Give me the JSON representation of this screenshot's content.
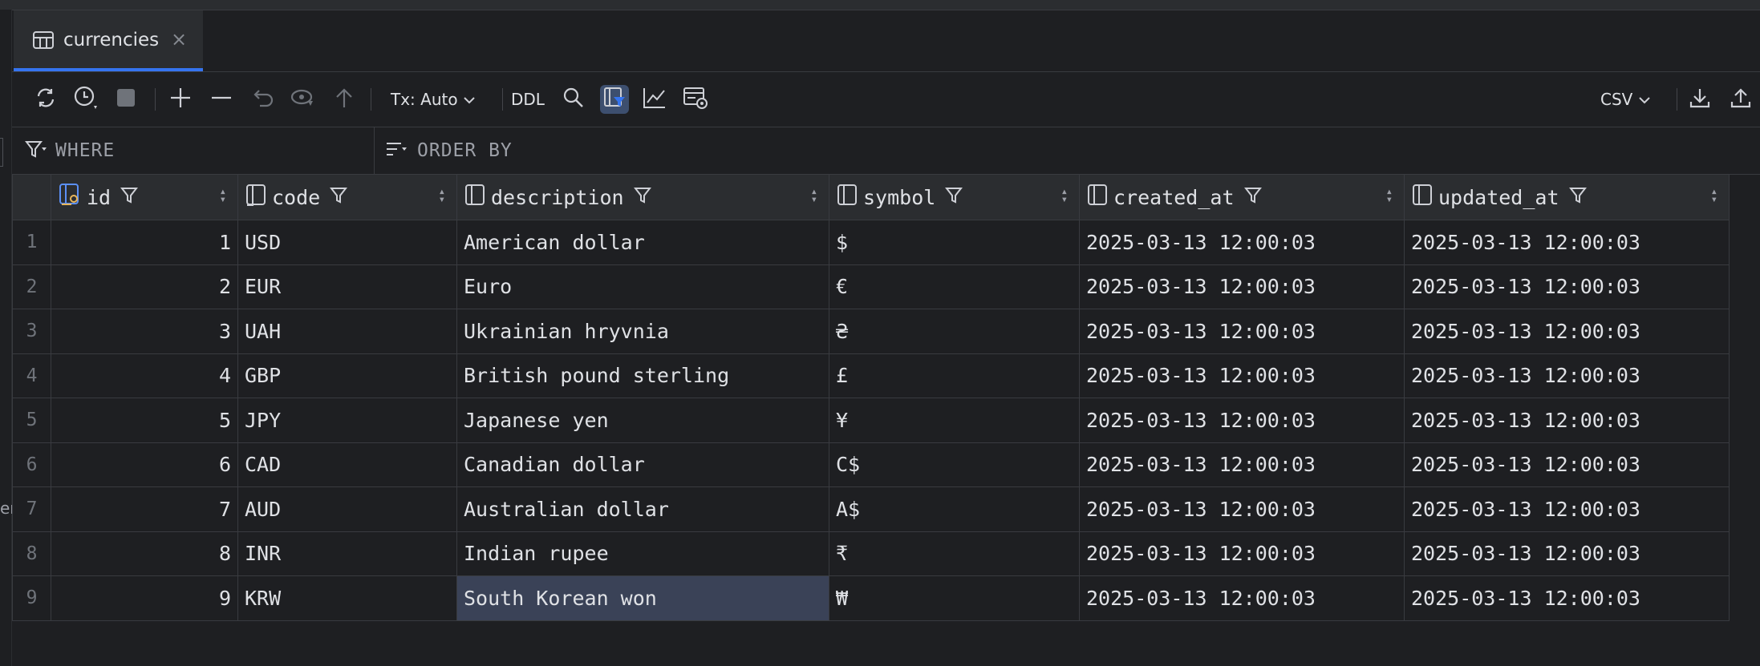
{
  "left_edge_text": "er",
  "tab": {
    "label": "currencies",
    "close": "×"
  },
  "toolbar": {
    "tx_label": "Tx: Auto",
    "ddl_label": "DDL",
    "export_format": "CSV"
  },
  "filters": {
    "where_label": "WHERE",
    "order_label": "ORDER BY"
  },
  "table": {
    "columns": [
      "id",
      "code",
      "description",
      "symbol",
      "created_at",
      "updated_at"
    ],
    "rows": [
      {
        "n": "1",
        "id": "1",
        "code": "USD",
        "description": "American dollar",
        "symbol": "$",
        "created_at": "2025-03-13 12:00:03",
        "updated_at": "2025-03-13 12:00:03"
      },
      {
        "n": "2",
        "id": "2",
        "code": "EUR",
        "description": "Euro",
        "symbol": "€",
        "created_at": "2025-03-13 12:00:03",
        "updated_at": "2025-03-13 12:00:03"
      },
      {
        "n": "3",
        "id": "3",
        "code": "UAH",
        "description": "Ukrainian hryvnia",
        "symbol": "₴",
        "created_at": "2025-03-13 12:00:03",
        "updated_at": "2025-03-13 12:00:03"
      },
      {
        "n": "4",
        "id": "4",
        "code": "GBP",
        "description": "British pound sterling",
        "symbol": "£",
        "created_at": "2025-03-13 12:00:03",
        "updated_at": "2025-03-13 12:00:03"
      },
      {
        "n": "5",
        "id": "5",
        "code": "JPY",
        "description": "Japanese yen",
        "symbol": "¥",
        "created_at": "2025-03-13 12:00:03",
        "updated_at": "2025-03-13 12:00:03"
      },
      {
        "n": "6",
        "id": "6",
        "code": "CAD",
        "description": "Canadian dollar",
        "symbol": "C$",
        "created_at": "2025-03-13 12:00:03",
        "updated_at": "2025-03-13 12:00:03"
      },
      {
        "n": "7",
        "id": "7",
        "code": "AUD",
        "description": "Australian dollar",
        "symbol": "A$",
        "created_at": "2025-03-13 12:00:03",
        "updated_at": "2025-03-13 12:00:03"
      },
      {
        "n": "8",
        "id": "8",
        "code": "INR",
        "description": "Indian rupee",
        "symbol": "₹",
        "created_at": "2025-03-13 12:00:03",
        "updated_at": "2025-03-13 12:00:03"
      },
      {
        "n": "9",
        "id": "9",
        "code": "KRW",
        "description": "South Korean won",
        "symbol": "₩",
        "created_at": "2025-03-13 12:00:03",
        "updated_at": "2025-03-13 12:00:03"
      }
    ]
  },
  "icons": [
    "table-icon",
    "refresh-icon",
    "history-icon",
    "stop-icon",
    "add-row-icon",
    "delete-row-icon",
    "revert-icon",
    "submit-icon",
    "push-icon",
    "chevron-down-icon",
    "search-icon",
    "filter-view-icon",
    "chart-icon",
    "compare-icon",
    "download-icon",
    "upload-icon",
    "filter-icon",
    "sort-icon",
    "primary-key-column-icon",
    "column-icon",
    "sort-arrows-icon"
  ],
  "colors": {
    "accent": "#3574f0",
    "background": "#1e1f22",
    "header": "#2b2d30",
    "selection": "#3a4257"
  }
}
